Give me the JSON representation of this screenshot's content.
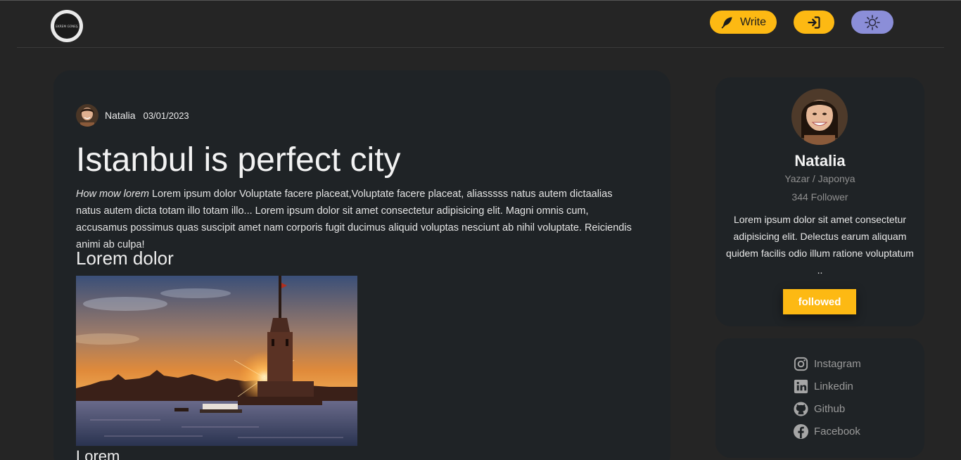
{
  "header": {
    "logo_text": "EKREM GÜNEŞ",
    "write_label": "Write"
  },
  "article": {
    "author": "Natalia",
    "date": "03/01/2023",
    "title": "Istanbul is perfect city",
    "intro_italic": "How mow lorem",
    "body": " Lorem ipsum dolor Voluptate facere placeat,Voluptate facere placeat, aliasssss natus autem dictaalias natus autem dicta totam illo totam illo... Lorem ipsum dolor sit amet consectetur adipisicing elit. Magni omnis cum, accusamus possimus quas suscipit amet nam corporis fugit ducimus aliquid voluptas nesciunt ab nihil voluptate. Reiciendis animi ab culpa!",
    "subheading": "Lorem dolor",
    "subheading2": "Lorem"
  },
  "profile": {
    "name": "Natalia",
    "role": "Yazar / Japonya",
    "followers": "344 Follower",
    "bio": "Lorem ipsum dolor sit amet consectetur adipisicing elit. Delectus earum aliquam quidem facilis odio illum ratione voluptatum ..",
    "follow_label": "followed"
  },
  "social": {
    "instagram": "Instagram",
    "linkedin": "Linkedin",
    "github": "Github",
    "facebook": "Facebook"
  },
  "colors": {
    "accent": "#fdb913",
    "theme_toggle": "#8b8ed8",
    "card_bg": "#1f2326",
    "page_bg": "#252525"
  }
}
